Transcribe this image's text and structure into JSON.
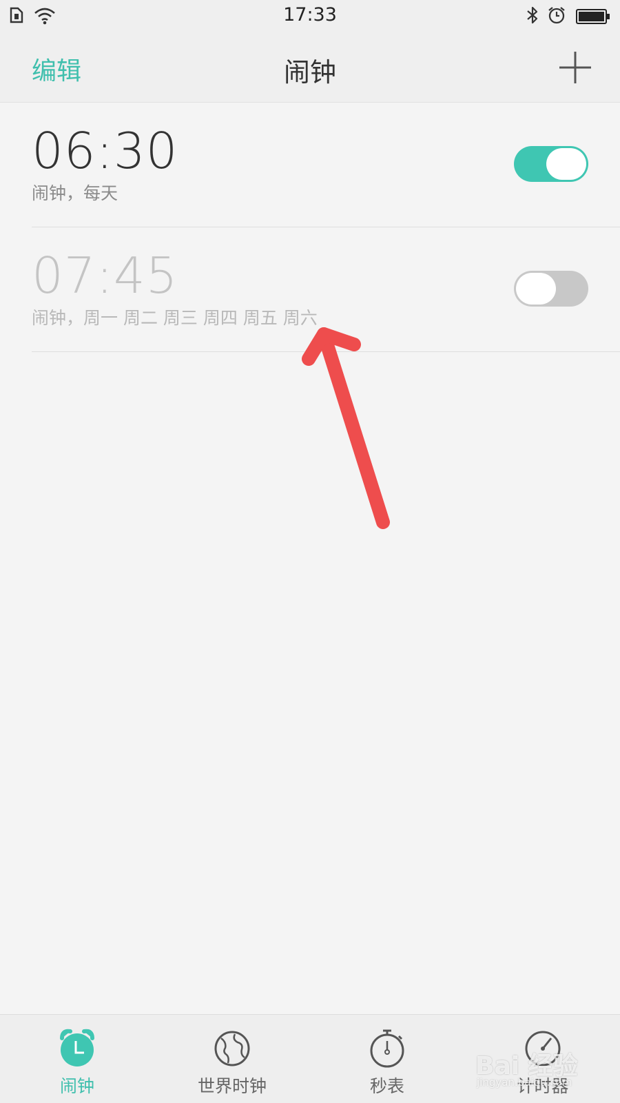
{
  "status_bar": {
    "time": "17:33",
    "icons": [
      "sim-card-icon",
      "wifi-icon",
      "bluetooth-icon",
      "alarm-clock-icon",
      "battery-icon"
    ]
  },
  "header": {
    "edit_label": "编辑",
    "title": "闹钟",
    "add_icon": "plus-icon"
  },
  "alarms": [
    {
      "time": "06:30",
      "description": "闹钟，每天",
      "enabled": true
    },
    {
      "time": "07:45",
      "description": "闹钟，周一 周二 周三 周四 周五 周六",
      "enabled": false
    }
  ],
  "tabs": [
    {
      "label": "闹钟",
      "icon": "alarm-clock-icon",
      "active": true
    },
    {
      "label": "世界时钟",
      "icon": "globe-icon",
      "active": false
    },
    {
      "label": "秒表",
      "icon": "stopwatch-icon",
      "active": false
    },
    {
      "label": "计时器",
      "icon": "timer-icon",
      "active": false
    }
  ],
  "watermark": {
    "text": "Bai 经验",
    "sub": "jingyan.baidu.com"
  },
  "colors": {
    "accent": "#3fbfad",
    "toggle_on": "#3fc6b2",
    "toggle_off": "#c8c8c8",
    "annotation": "#ee4d4d",
    "background": "#f4f4f4"
  }
}
